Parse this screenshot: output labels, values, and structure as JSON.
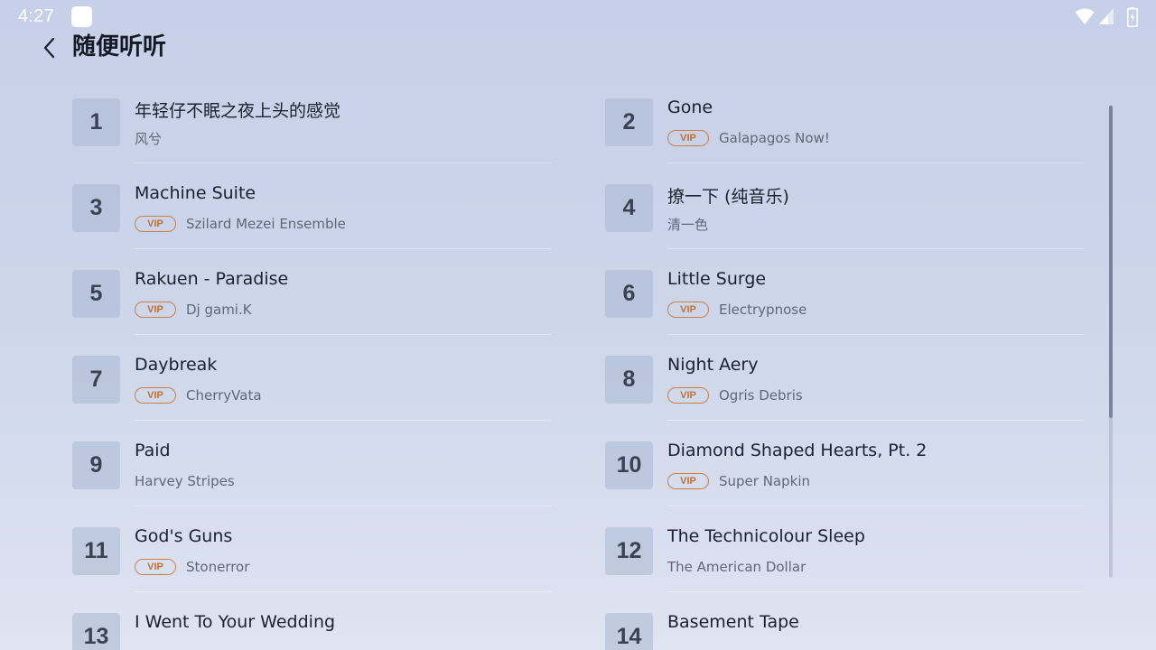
{
  "status_bar": {
    "time": "4:27",
    "icons": [
      "app-notification-icon",
      "wifi-icon",
      "cell-signal-icon",
      "battery-charging-icon"
    ]
  },
  "header": {
    "back_icon": "chevron-left-icon",
    "title": "随便听听"
  },
  "colors": {
    "background_top": "#c6d0e8",
    "background_bottom": "#dfe4f1",
    "vip_accent": "#c27032",
    "rank_box": "#b4c0d8"
  },
  "vip_label": "VIP",
  "songs": [
    {
      "rank": "1",
      "title": "年轻仔不眠之夜上头的感觉",
      "artist": "风兮",
      "vip": false
    },
    {
      "rank": "2",
      "title": "Gone",
      "artist": "Galapagos Now!",
      "vip": true
    },
    {
      "rank": "3",
      "title": "Machine Suite",
      "artist": "Szilard Mezei Ensemble",
      "vip": true
    },
    {
      "rank": "4",
      "title": "撩一下 (纯音乐)",
      "artist": "清一色",
      "vip": false
    },
    {
      "rank": "5",
      "title": "Rakuen - Paradise",
      "artist": "Dj gami.K",
      "vip": true
    },
    {
      "rank": "6",
      "title": "Little Surge",
      "artist": "Electrypnose",
      "vip": true
    },
    {
      "rank": "7",
      "title": "Daybreak",
      "artist": "CherryVata",
      "vip": true
    },
    {
      "rank": "8",
      "title": "Night Aery",
      "artist": "Ogris Debris",
      "vip": true
    },
    {
      "rank": "9",
      "title": "Paid",
      "artist": "Harvey Stripes",
      "vip": false
    },
    {
      "rank": "10",
      "title": "Diamond Shaped Hearts, Pt. 2",
      "artist": "Super Napkin",
      "vip": true
    },
    {
      "rank": "11",
      "title": "God's Guns",
      "artist": "Stonerror",
      "vip": true
    },
    {
      "rank": "12",
      "title": "The Technicolour Sleep",
      "artist": "The American Dollar",
      "vip": false
    },
    {
      "rank": "13",
      "title": "I Went To Your Wedding",
      "artist": "",
      "vip": false
    },
    {
      "rank": "14",
      "title": "Basement Tape",
      "artist": "",
      "vip": false
    }
  ]
}
